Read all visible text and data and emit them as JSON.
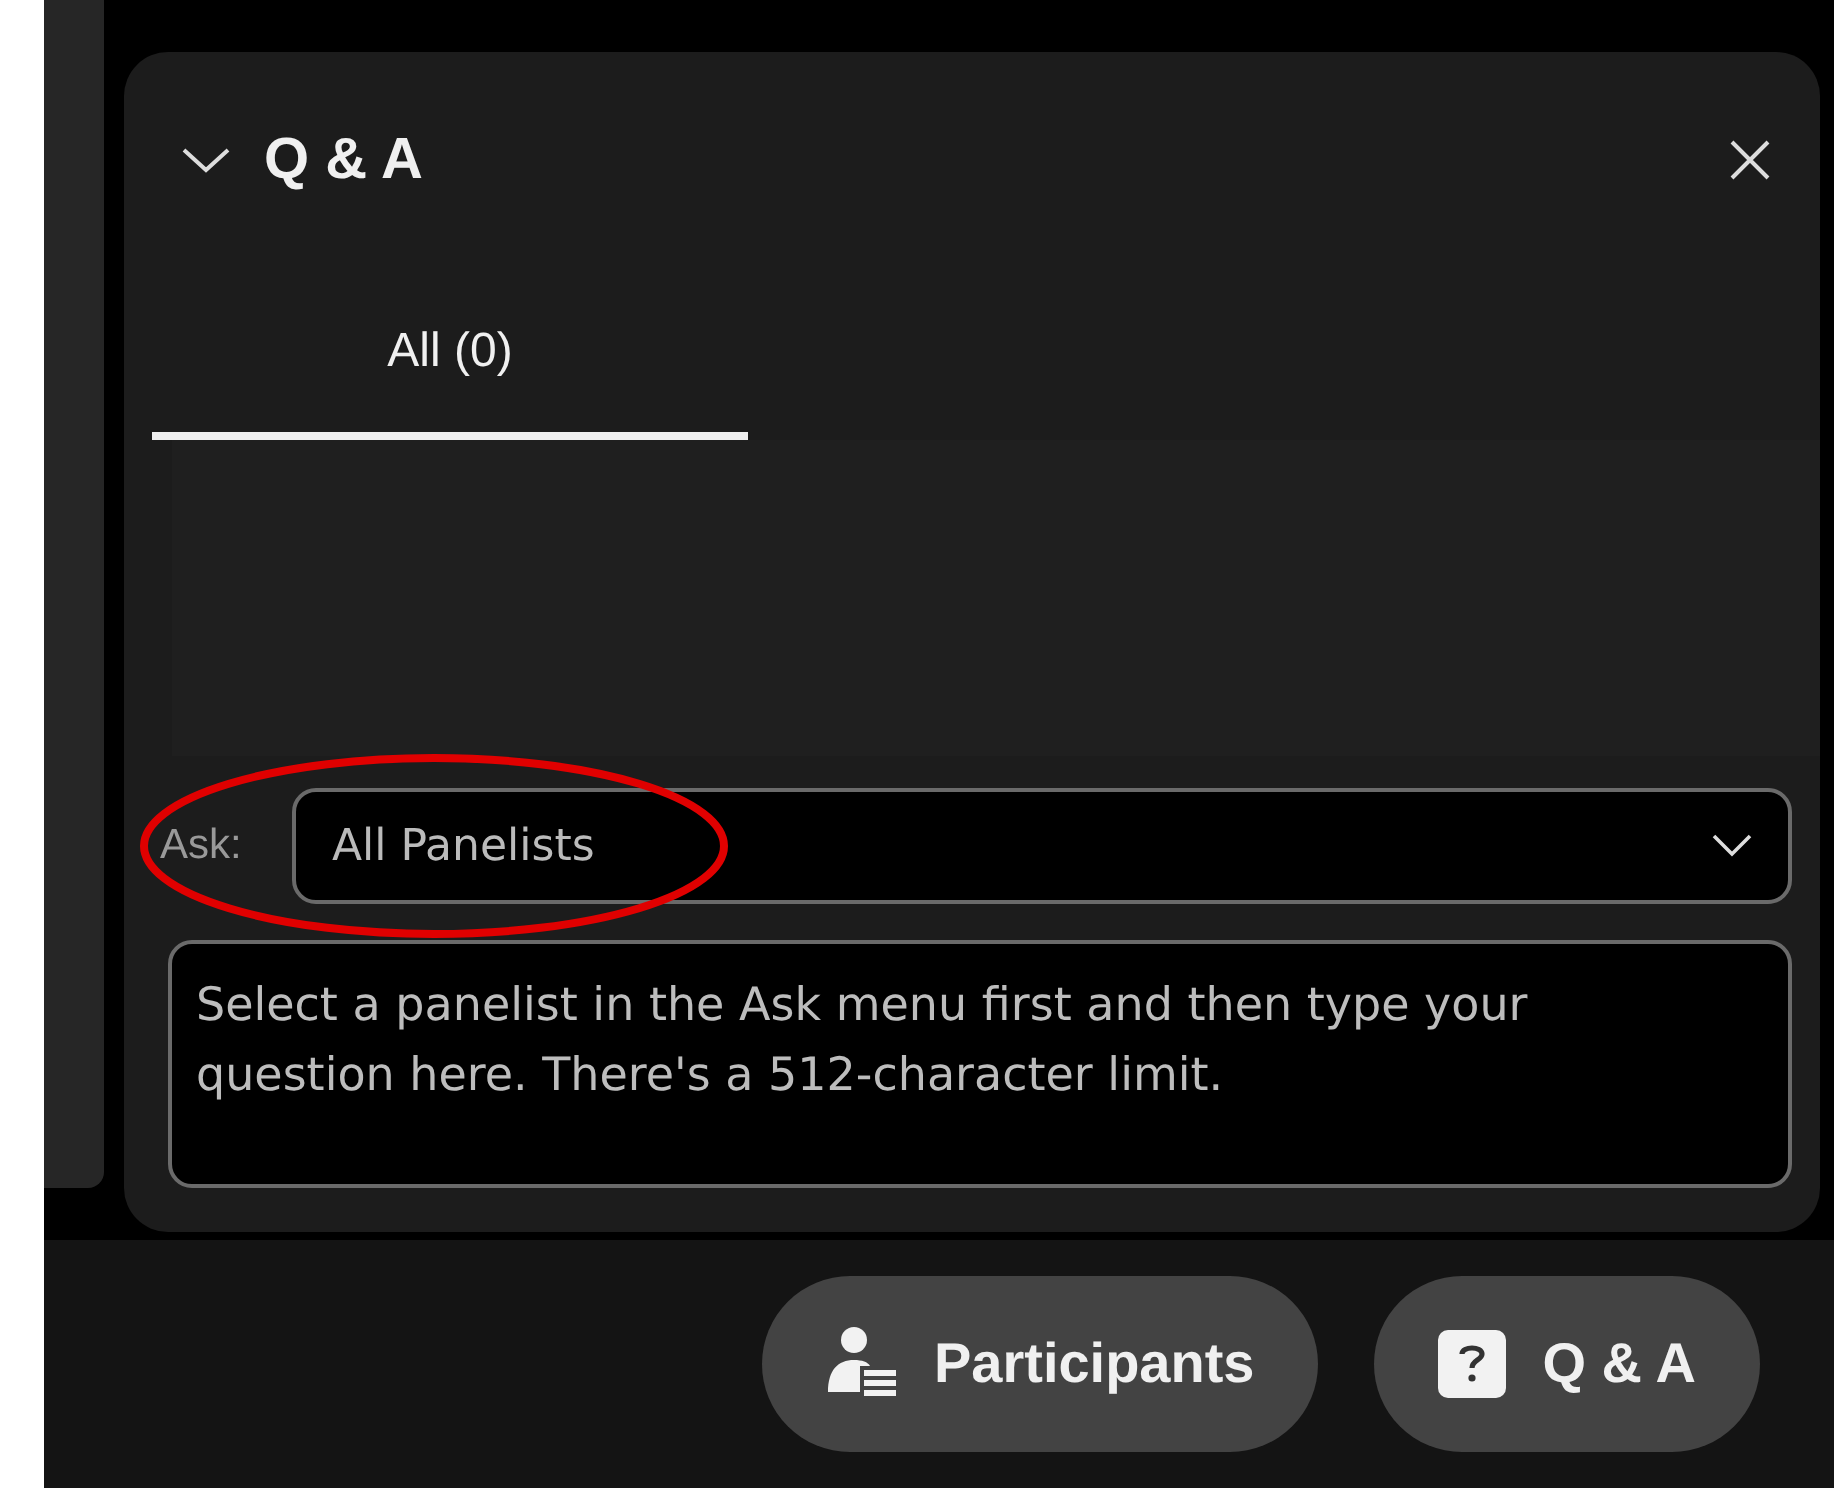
{
  "panel": {
    "title": "Q & A",
    "expanded": true
  },
  "tabs": [
    {
      "label": "All (0)",
      "selected": true
    }
  ],
  "ask": {
    "label": "Ask:",
    "value": "All Panelists"
  },
  "question_box": {
    "placeholder": "Select a panelist in the Ask menu first and then type your question here. There's a 512-character limit."
  },
  "toolbar": [
    {
      "kind": "participants",
      "label": "Participants"
    },
    {
      "kind": "qa",
      "label": "Q & A"
    }
  ]
}
